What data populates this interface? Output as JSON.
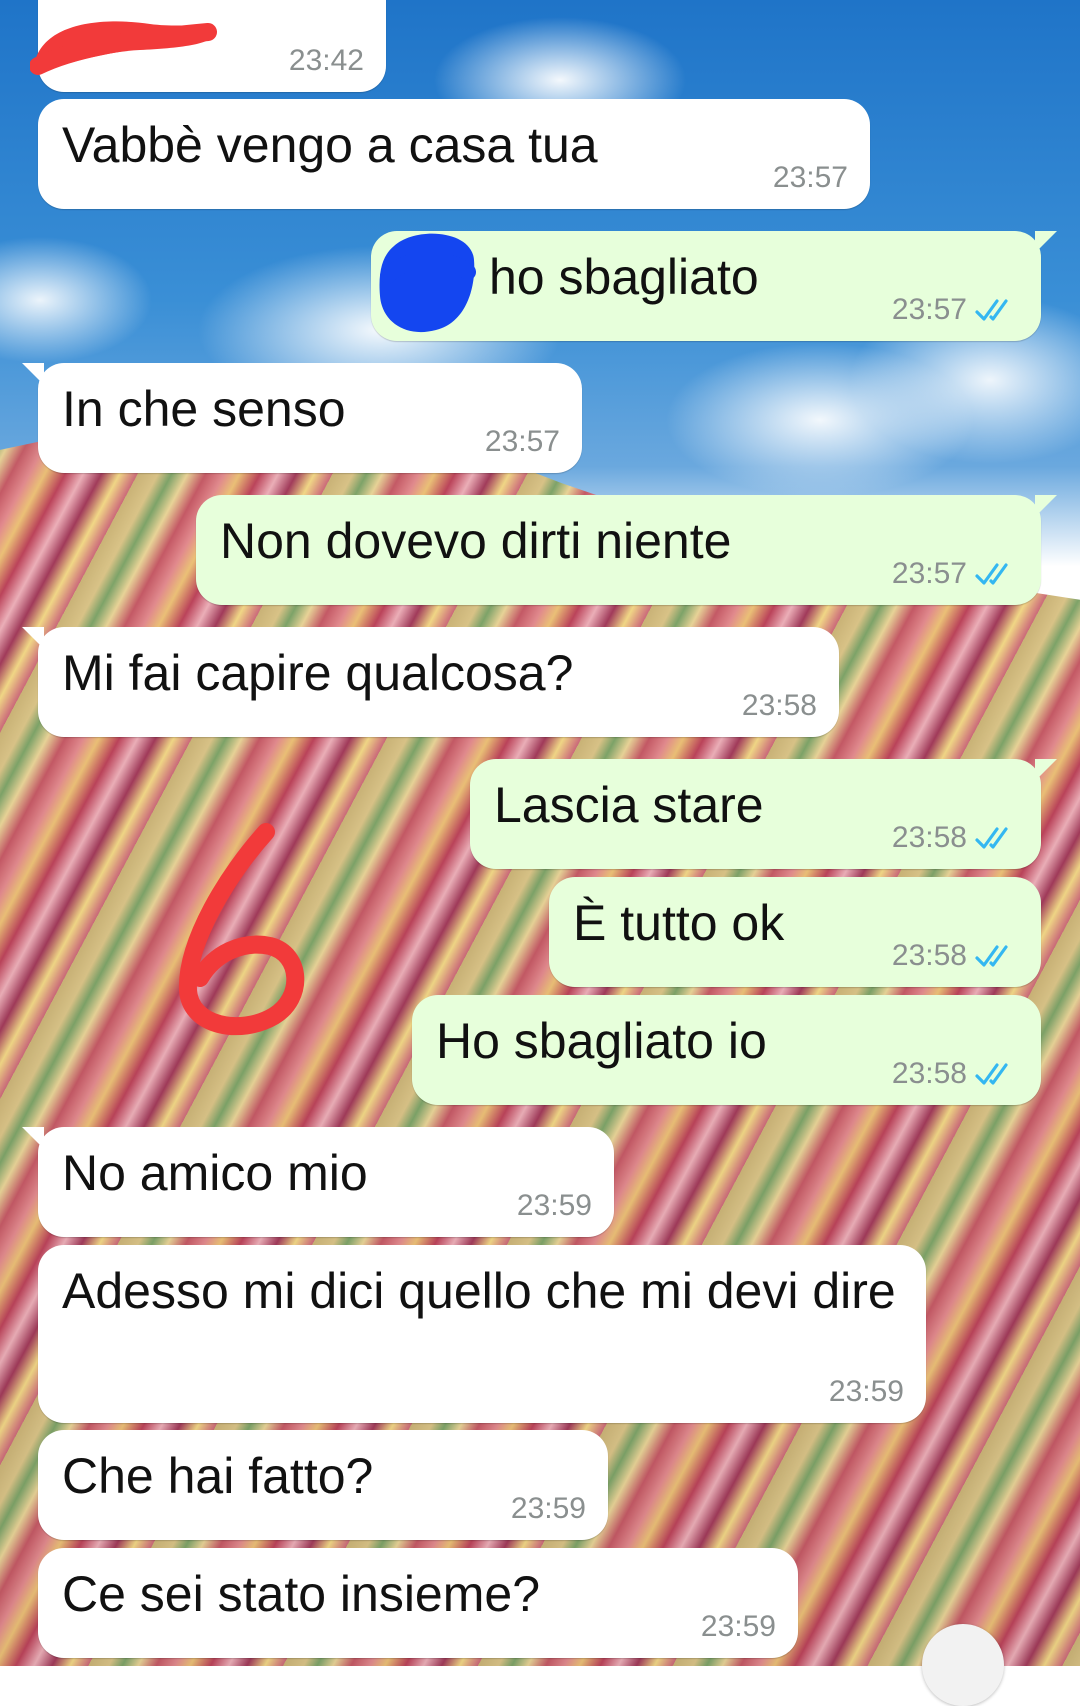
{
  "chat": {
    "messages": [
      {
        "id": "m0",
        "direction": "incoming",
        "text": "",
        "time": "23:42"
      },
      {
        "id": "m1",
        "direction": "incoming",
        "text": "Vabbè vengo a casa tua",
        "time": "23:57"
      },
      {
        "id": "m2",
        "direction": "outgoing",
        "text": "ho sbagliato",
        "time": "23:57",
        "status": "read"
      },
      {
        "id": "m3",
        "direction": "incoming",
        "text": "In che senso",
        "time": "23:57"
      },
      {
        "id": "m4",
        "direction": "outgoing",
        "text": "Non dovevo dirti niente",
        "time": "23:57",
        "status": "read"
      },
      {
        "id": "m5",
        "direction": "incoming",
        "text": "Mi fai capire qualcosa?",
        "time": "23:58"
      },
      {
        "id": "m6",
        "direction": "outgoing",
        "text": "Lascia stare",
        "time": "23:58",
        "status": "read"
      },
      {
        "id": "m7",
        "direction": "outgoing",
        "text": "È tutto ok",
        "time": "23:58",
        "status": "read"
      },
      {
        "id": "m8",
        "direction": "outgoing",
        "text": "Ho sbagliato io",
        "time": "23:58",
        "status": "read"
      },
      {
        "id": "m9",
        "direction": "incoming",
        "text": "No amico mio",
        "time": "23:59"
      },
      {
        "id": "m10",
        "direction": "incoming",
        "text": "Adesso mi dici quello che mi devi dire",
        "time": "23:59"
      },
      {
        "id": "m11",
        "direction": "incoming",
        "text": "Che hai fatto?",
        "time": "23:59"
      },
      {
        "id": "m12",
        "direction": "incoming",
        "text": "Ce sei stato insieme?",
        "time": "23:59"
      }
    ]
  },
  "annotation": {
    "label": "6"
  },
  "colors": {
    "incoming_bubble": "#ffffff",
    "outgoing_bubble": "#e7ffdb",
    "read_ticks": "#34b7f1",
    "annotation_red": "#f23a3a",
    "redaction_blue": "#1446f0"
  },
  "icons": {
    "read_receipt": "double-check-icon"
  }
}
